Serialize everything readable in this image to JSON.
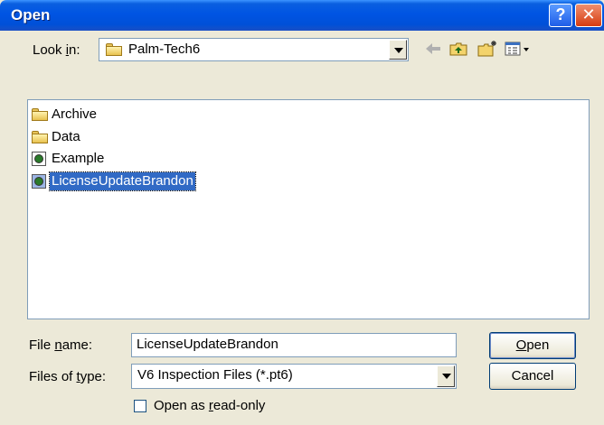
{
  "window": {
    "title": "Open"
  },
  "title_buttons": {
    "help": "?",
    "close": "✕"
  },
  "lookin": {
    "label_pre": "Look ",
    "label_ul": "i",
    "label_post": "n:",
    "value": "Palm-Tech6"
  },
  "toolbar": {
    "icons": [
      "back-arrow-icon",
      "up-one-level-icon",
      "new-folder-icon",
      "views-menu-icon"
    ]
  },
  "files": [
    {
      "name": "Archive",
      "type": "folder"
    },
    {
      "name": "Data",
      "type": "folder"
    },
    {
      "name": "Example",
      "type": "file"
    },
    {
      "name": "LicenseUpdateBrandon",
      "type": "file",
      "selected": true
    }
  ],
  "filename": {
    "label_pre": "File ",
    "label_ul": "n",
    "label_post": "ame:",
    "value": "LicenseUpdateBrandon"
  },
  "filetype": {
    "label_pre": "Files of ",
    "label_ul": "t",
    "label_post": "ype:",
    "value": "V6 Inspection Files (*.pt6)"
  },
  "buttons": {
    "open_ul": "O",
    "open_rest": "pen",
    "cancel": "Cancel"
  },
  "readonly": {
    "label_pre": "Open as ",
    "label_ul": "r",
    "label_post": "ead-only",
    "checked": false
  },
  "colors": {
    "titlebar": "#0054e3",
    "selection": "#316ac5",
    "dialog_bg": "#ece9d8"
  }
}
